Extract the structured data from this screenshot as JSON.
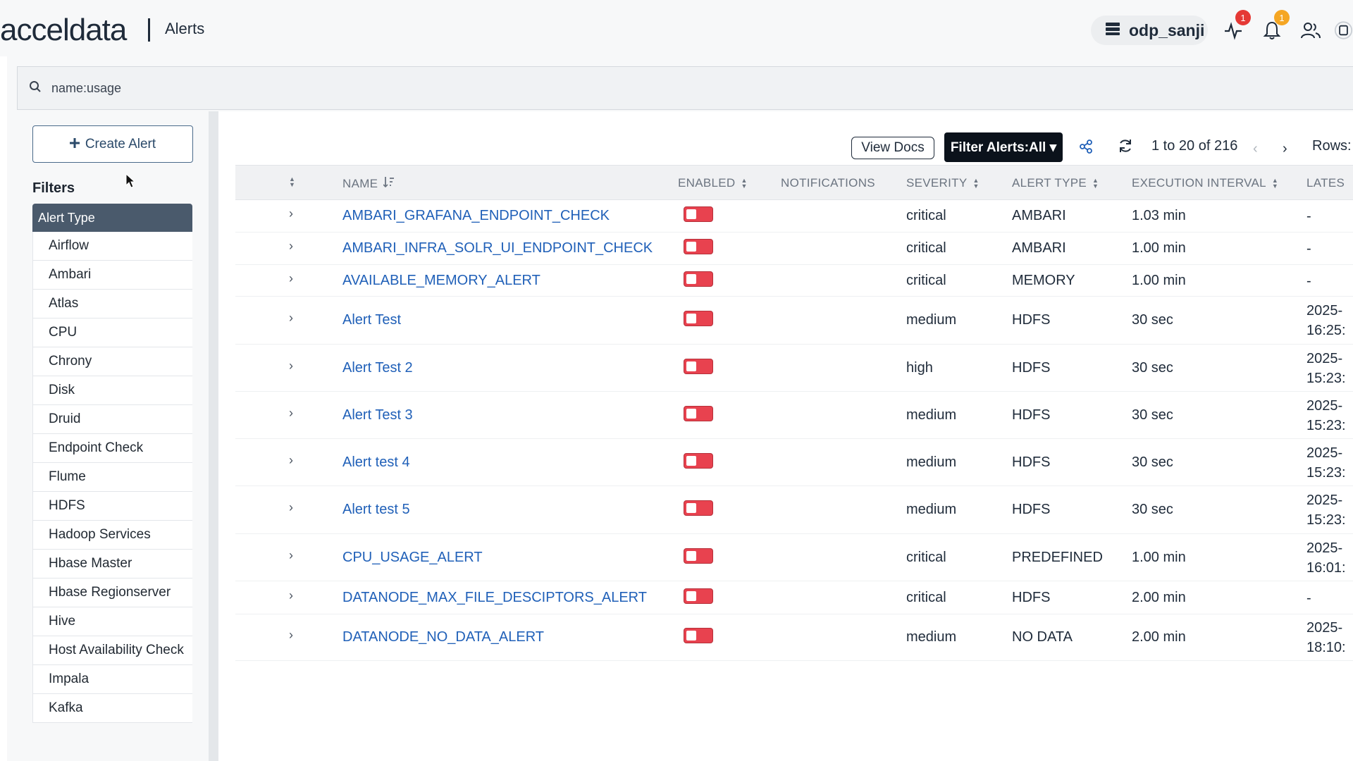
{
  "header": {
    "logo_text": "acceldata",
    "page_title": "Alerts",
    "cluster": "odp_sanji",
    "pulse_badge": "1",
    "bell_badge": "1"
  },
  "search": {
    "value": "name:usage"
  },
  "left_panel": {
    "create_label": "Create Alert",
    "filters_title": "Filters",
    "filter_group": "Alert Type",
    "filter_items": [
      "Airflow",
      "Ambari",
      "Atlas",
      "CPU",
      "Chrony",
      "Disk",
      "Druid",
      "Endpoint Check",
      "Flume",
      "HDFS",
      "Hadoop Services",
      "Hbase Master",
      "Hbase Regionserver",
      "Hive",
      "Host Availability Check",
      "Impala",
      "Kafka"
    ]
  },
  "toolbar": {
    "view_docs": "View Docs",
    "filter_alerts": "Filter Alerts:All",
    "page_info": "1 to 20 of 216",
    "rows_label": "Rows:"
  },
  "table": {
    "headers": {
      "name": "NAME",
      "enabled": "ENABLED",
      "notifications": "NOTIFICATIONS",
      "severity": "SEVERITY",
      "alert_type": "ALERT TYPE",
      "execution_interval": "EXECUTION INTERVAL",
      "latest": "LATES"
    },
    "rows": [
      {
        "name": "AMBARI_GRAFANA_ENDPOINT_CHECK",
        "severity": "critical",
        "type": "AMBARI",
        "interval": "1.03 min",
        "latest1": "-",
        "latest2": ""
      },
      {
        "name": "AMBARI_INFRA_SOLR_UI_ENDPOINT_CHECK",
        "severity": "critical",
        "type": "AMBARI",
        "interval": "1.00 min",
        "latest1": "-",
        "latest2": ""
      },
      {
        "name": "AVAILABLE_MEMORY_ALERT",
        "severity": "critical",
        "type": "MEMORY",
        "interval": "1.00 min",
        "latest1": "-",
        "latest2": ""
      },
      {
        "name": "Alert Test",
        "severity": "medium",
        "type": "HDFS",
        "interval": "30 sec",
        "latest1": "2025-",
        "latest2": "16:25:"
      },
      {
        "name": "Alert Test 2",
        "severity": "high",
        "type": "HDFS",
        "interval": "30 sec",
        "latest1": "2025-",
        "latest2": "15:23:"
      },
      {
        "name": "Alert Test 3",
        "severity": "medium",
        "type": "HDFS",
        "interval": "30 sec",
        "latest1": "2025-",
        "latest2": "15:23:"
      },
      {
        "name": "Alert test 4",
        "severity": "medium",
        "type": "HDFS",
        "interval": "30 sec",
        "latest1": "2025-",
        "latest2": "15:23:"
      },
      {
        "name": "Alert test 5",
        "severity": "medium",
        "type": "HDFS",
        "interval": "30 sec",
        "latest1": "2025-",
        "latest2": "15:23:"
      },
      {
        "name": "CPU_USAGE_ALERT",
        "severity": "critical",
        "type": "PREDEFINED",
        "interval": "1.00 min",
        "latest1": "2025-",
        "latest2": "16:01:"
      },
      {
        "name": "DATANODE_MAX_FILE_DESCIPTORS_ALERT",
        "severity": "critical",
        "type": "HDFS",
        "interval": "2.00 min",
        "latest1": "-",
        "latest2": ""
      },
      {
        "name": "DATANODE_NO_DATA_ALERT",
        "severity": "medium",
        "type": "NO DATA",
        "interval": "2.00 min",
        "latest1": "2025-",
        "latest2": "18:10:"
      }
    ]
  },
  "colors": {
    "toggle_off": "#e8424f",
    "link": "#2060b8",
    "badge_red": "#e53935",
    "badge_orange": "#f5a623"
  }
}
